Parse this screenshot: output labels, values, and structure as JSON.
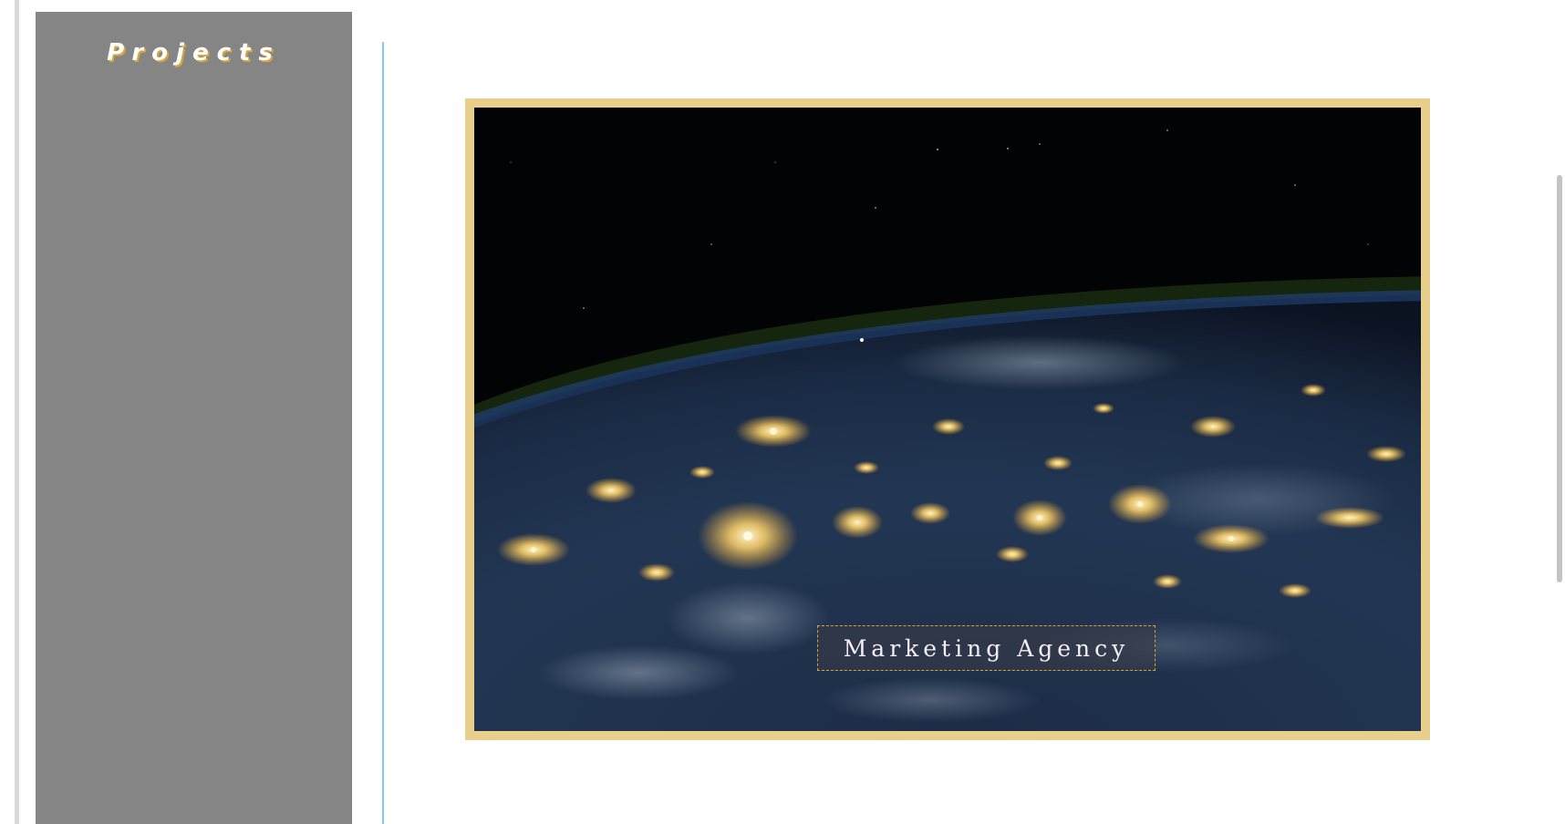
{
  "sidebar": {
    "title": "Projects"
  },
  "project": {
    "label": "Marketing Agency",
    "image": "earth-at-night-photo"
  },
  "colors": {
    "sidebar_bg": "#858585",
    "title_shadow": "#d9a53c",
    "divider": "#87c9ee",
    "card_frame": "#e8d08c",
    "label_border": "#d6a52a"
  }
}
